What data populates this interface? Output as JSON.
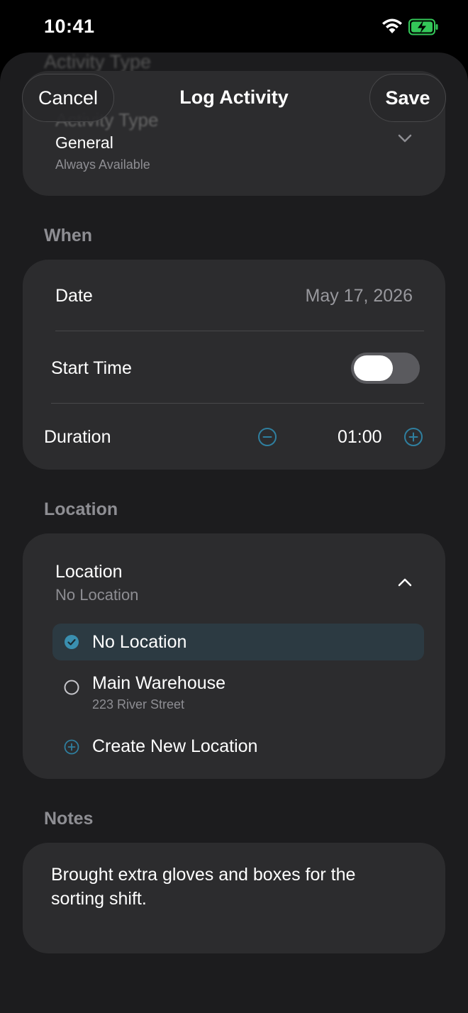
{
  "status_bar": {
    "time": "10:41"
  },
  "nav": {
    "ghost_title": "Activity Type",
    "cancel_label": "Cancel",
    "title": "Log Activity",
    "save_label": "Save"
  },
  "activity": {
    "label": "Activity Type",
    "value": "General",
    "subtitle": "Always Available"
  },
  "when": {
    "header": "When",
    "date_label": "Date",
    "date_value": "May 17, 2026",
    "start_time_label": "Start Time",
    "start_time_enabled": true,
    "duration_label": "Duration",
    "duration_value": "01:00"
  },
  "location": {
    "header": "Location",
    "title": "Location",
    "selected": "No Location",
    "options": [
      {
        "label": "No Location",
        "selected": true
      },
      {
        "label": "Main Warehouse",
        "address": "223 River Street",
        "selected": false
      }
    ],
    "create_label": "Create New Location"
  },
  "notes": {
    "header": "Notes",
    "text": "Brought extra gloves and boxes for the sorting shift."
  },
  "colors": {
    "background": "#1c1c1e",
    "card": "#2c2c2e",
    "accent": "#3a8fb0",
    "secondary_text": "#8e8e93",
    "battery_green": "#34c759"
  }
}
